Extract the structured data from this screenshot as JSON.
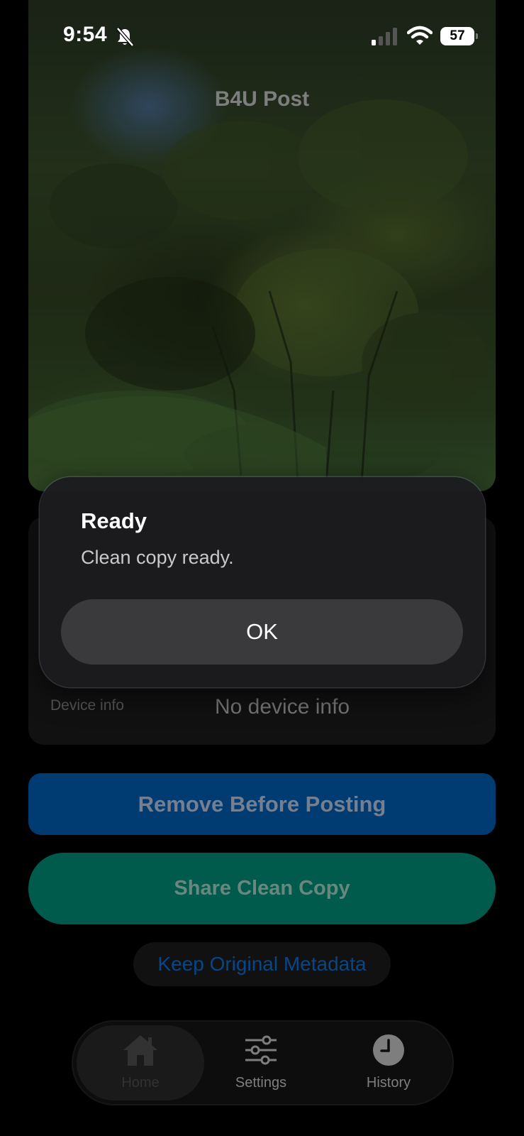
{
  "status_bar": {
    "time": "9:54",
    "battery": "57",
    "icons": [
      "bell-slash-icon",
      "cellular-signal-icon",
      "wifi-icon",
      "battery-icon"
    ]
  },
  "app": {
    "title": "B4U Post"
  },
  "info_card": {
    "device_label": "Device info",
    "device_value": "No device info"
  },
  "actions": {
    "remove_label": "Remove Before Posting",
    "share_label": "Share Clean Copy",
    "keep_label": "Keep Original Metadata"
  },
  "tab_bar": {
    "tabs": [
      {
        "label": "Home",
        "icon": "house-icon",
        "selected": true
      },
      {
        "label": "Settings",
        "icon": "sliders-icon",
        "selected": false
      },
      {
        "label": "History",
        "icon": "clock-icon",
        "selected": false
      }
    ]
  },
  "alert": {
    "title": "Ready",
    "message": "Clean copy ready.",
    "ok_label": "OK"
  },
  "colors": {
    "remove_button": "#00488a",
    "share_button": "#00705f",
    "keep_text": "#0a56a4",
    "alert_background": "#1c1c1e"
  }
}
